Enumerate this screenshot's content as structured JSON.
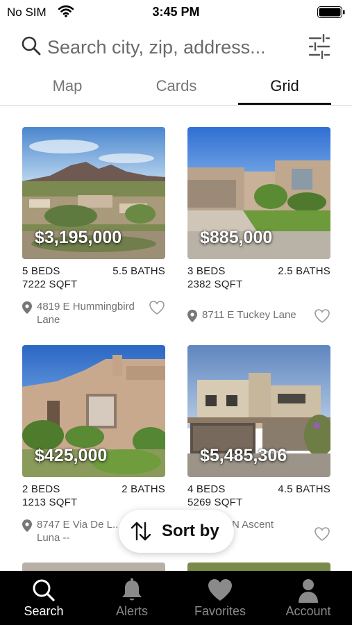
{
  "status_bar": {
    "carrier": "No SIM",
    "time": "3:45 PM"
  },
  "search": {
    "placeholder": "Search city, zip, address..."
  },
  "tabs": [
    {
      "label": "Map"
    },
    {
      "label": "Cards"
    },
    {
      "label": "Grid"
    }
  ],
  "active_tab": "Grid",
  "listings": [
    {
      "price": "$3,195,000",
      "beds": "5 BEDS",
      "baths": "5.5 BATHS",
      "sqft": "7222 SQFT",
      "address": "4819 E Hummingbird Lane"
    },
    {
      "price": "$885,000",
      "beds": "3 BEDS",
      "baths": "2.5 BATHS",
      "sqft": "2382 SQFT",
      "address": "8711 E Tuckey Lane"
    },
    {
      "price": "$425,000",
      "beds": "2 BEDS",
      "baths": "2 BATHS",
      "sqft": "1213 SQFT",
      "address": "8747 E Via De L... Luna --"
    },
    {
      "price": "$5,485,306",
      "beds": "4 BEDS",
      "baths": "4.5 BATHS",
      "sqft": "5269 SQFT",
      "address": "N Ascent"
    }
  ],
  "sort": {
    "label": "Sort by"
  },
  "nav": [
    {
      "label": "Search",
      "icon": "search-icon"
    },
    {
      "label": "Alerts",
      "icon": "bell-icon"
    },
    {
      "label": "Favorites",
      "icon": "heart-icon"
    },
    {
      "label": "Account",
      "icon": "person-icon"
    }
  ],
  "active_nav": "Search",
  "colors": {
    "nav_bg": "#000000",
    "nav_active": "#ffffff",
    "nav_inactive": "#8a8a8a",
    "tab_underline": "#111111"
  }
}
